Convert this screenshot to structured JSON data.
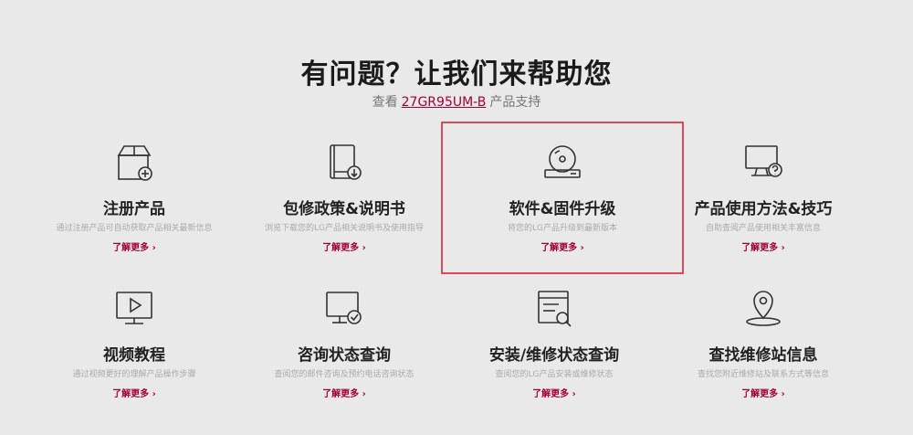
{
  "header": {
    "title": "有问题？让我们来帮助您",
    "subtitle_prefix": "查看",
    "model": "27GR95UM-B",
    "subtitle_suffix": "产品支持"
  },
  "cards": [
    {
      "title": "注册产品",
      "desc": "通过注册产品可自动获取产品相关最新信息",
      "more": "了解更多 ›",
      "icon": "box-add-icon"
    },
    {
      "title": "包修政策&说明书",
      "desc": "浏览下载您的LG产品相关说明书及使用指导",
      "more": "了解更多 ›",
      "icon": "manual-download-icon"
    },
    {
      "title": "软件&固件升级",
      "desc": "将您的LG产品升级到最新版本",
      "more": "了解更多 ›",
      "icon": "disc-drive-icon"
    },
    {
      "title": "产品使用方法&技巧",
      "desc": "自助查阅产品使用相关丰富信息",
      "more": "了解更多 ›",
      "icon": "monitor-help-icon"
    },
    {
      "title": "视频教程",
      "desc": "通过视频更好的理解产品操作步骤",
      "more": "了解更多 ›",
      "icon": "video-play-icon"
    },
    {
      "title": "咨询状态查询",
      "desc": "查阅您的邮件咨询及预约电话咨询状态",
      "more": "了解更多 ›",
      "icon": "monitor-check-icon"
    },
    {
      "title": "安装/维修状态查询",
      "desc": "查阅您的LG产品安装或维修状态",
      "more": "了解更多 ›",
      "icon": "status-search-icon"
    },
    {
      "title": "查找维修站信息",
      "desc": "查找您附近维修站及联系方式等信息",
      "more": "了解更多 ›",
      "icon": "location-pin-icon"
    }
  ],
  "colors": {
    "accent": "#a50034",
    "highlight_border": "#d94b5a",
    "background": "#e9e9ea"
  }
}
